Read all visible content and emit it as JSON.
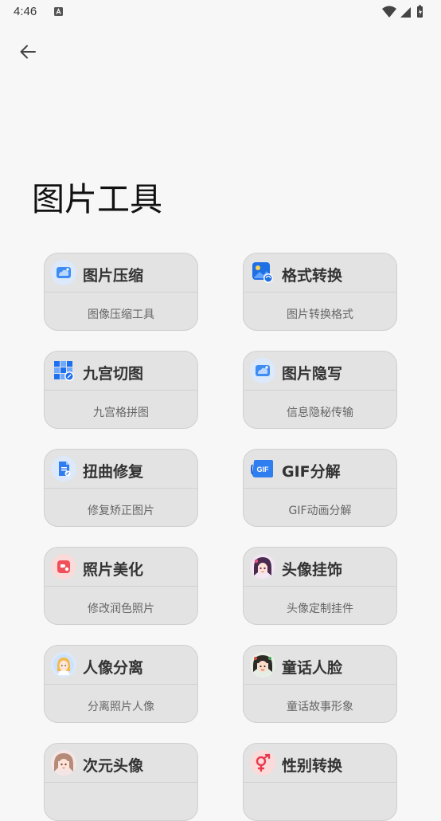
{
  "status_bar": {
    "time": "4:46"
  },
  "page": {
    "title": "图片工具"
  },
  "tools": [
    {
      "title": "图片压缩",
      "subtitle": "图像压缩工具",
      "icon": "cloud-image-icon"
    },
    {
      "title": "格式转换",
      "subtitle": "图片转换格式",
      "icon": "format-convert-icon"
    },
    {
      "title": "九宫切图",
      "subtitle": "九宫格拼图",
      "icon": "nine-grid-icon"
    },
    {
      "title": "图片隐写",
      "subtitle": "信息隐秘传输",
      "icon": "cloud-image-icon"
    },
    {
      "title": "扭曲修复",
      "subtitle": "修复矫正图片",
      "icon": "document-fix-icon"
    },
    {
      "title": "GIF分解",
      "subtitle": "GIF动画分解",
      "icon": "gif-icon"
    },
    {
      "title": "照片美化",
      "subtitle": "修改润色照片",
      "icon": "beautify-icon"
    },
    {
      "title": "头像挂饰",
      "subtitle": "头像定制挂件",
      "icon": "avatar-anime-icon"
    },
    {
      "title": "人像分离",
      "subtitle": "分离照片人像",
      "icon": "portrait-icon"
    },
    {
      "title": "童话人脸",
      "subtitle": "童话故事形象",
      "icon": "fairytale-face-icon"
    },
    {
      "title": "次元头像",
      "subtitle": "",
      "icon": "anime-avatar-icon"
    },
    {
      "title": "性别转换",
      "subtitle": "",
      "icon": "gender-swap-icon"
    }
  ]
}
